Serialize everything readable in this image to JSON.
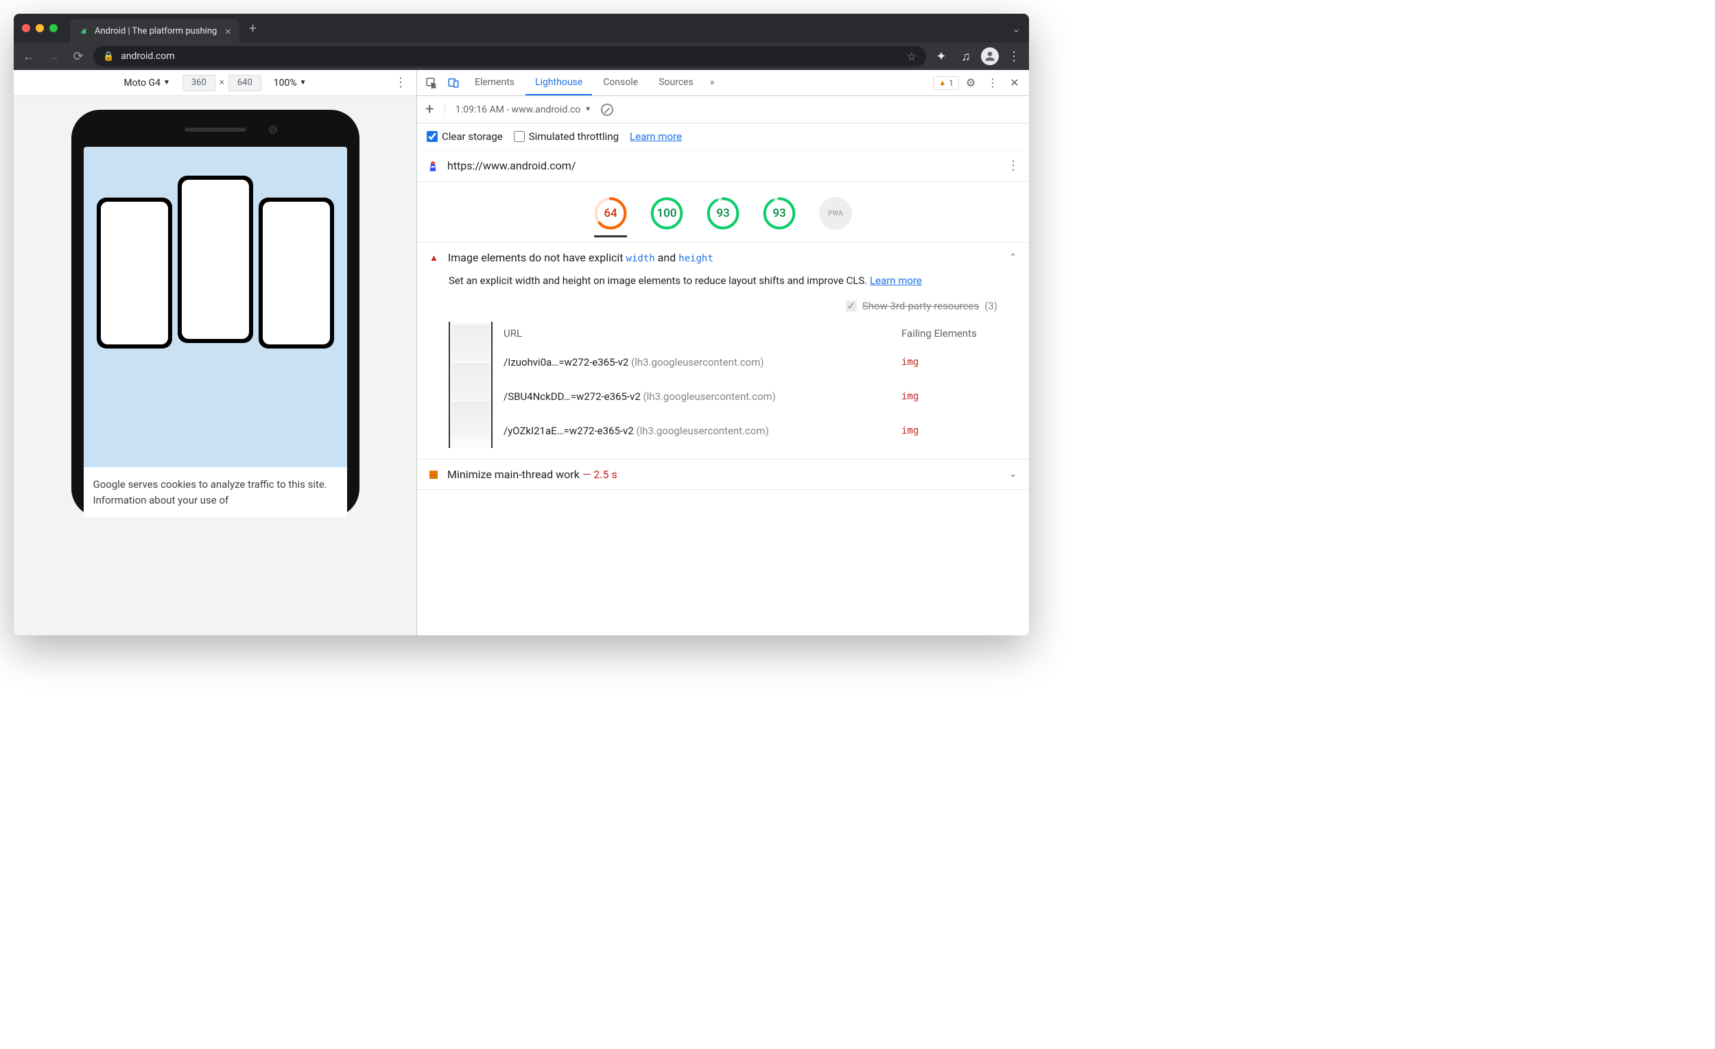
{
  "browser": {
    "tab_title": "Android | The platform pushing",
    "url": "android.com"
  },
  "device_toolbar": {
    "device": "Moto G4",
    "width": "360",
    "height": "640",
    "zoom": "100%"
  },
  "page_preview": {
    "cookie_text": "Google serves cookies to analyze traffic to this site. Information about your use of"
  },
  "devtools": {
    "tabs": [
      "Elements",
      "Lighthouse",
      "Console",
      "Sources"
    ],
    "active_tab": "Lighthouse",
    "warning_count": "1"
  },
  "lighthouse": {
    "report_label": "1:09:16 AM - www.android.co",
    "clear_storage_label": "Clear storage",
    "simulated_label": "Simulated throttling",
    "learn_more": "Learn more",
    "url": "https://www.android.com/",
    "scores": [
      {
        "value": "64",
        "class": "orange",
        "pct": 64
      },
      {
        "value": "100",
        "class": "green",
        "pct": 100
      },
      {
        "value": "93",
        "class": "green",
        "pct": 93
      },
      {
        "value": "93",
        "class": "green",
        "pct": 93
      },
      {
        "value": "PWA",
        "class": "gray",
        "pct": 0
      }
    ]
  },
  "audit_image": {
    "title_pre": "Image elements do not have explicit ",
    "code1": "width",
    "and": " and ",
    "code2": "height",
    "desc": "Set an explicit width and height on image elements to reduce layout shifts and improve CLS. ",
    "learn_more": "Learn more",
    "third_party_label": "Show 3rd-party resources",
    "third_party_count": "(3)",
    "table": {
      "col_url": "URL",
      "col_fail": "Failing Elements",
      "rows": [
        {
          "path": "/Izuohvi0a…=w272-e365-v2",
          "domain": "(lh3.googleusercontent.com)",
          "elem": "img"
        },
        {
          "path": "/SBU4NckDD…=w272-e365-v2",
          "domain": "(lh3.googleusercontent.com)",
          "elem": "img"
        },
        {
          "path": "/yOZkI21aE…=w272-e365-v2",
          "domain": "(lh3.googleusercontent.com)",
          "elem": "img"
        }
      ]
    }
  },
  "audit_thread": {
    "title": "Minimize main-thread work",
    "sep": " — ",
    "value": "2.5 s"
  }
}
